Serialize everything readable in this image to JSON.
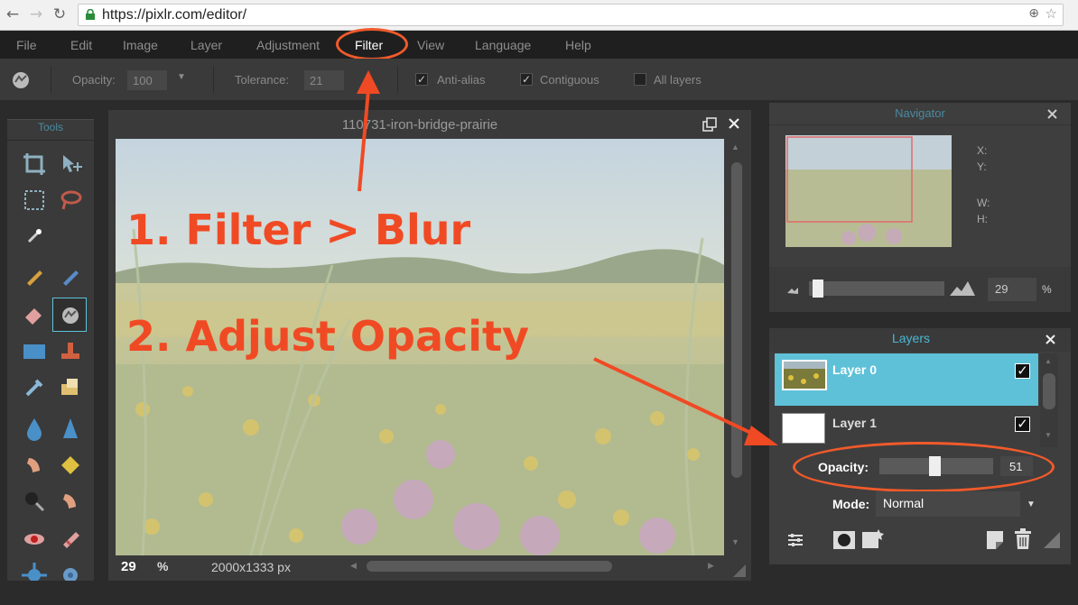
{
  "browser": {
    "url": "https://pixlr.com/editor/"
  },
  "menubar": {
    "items": [
      "File",
      "Edit",
      "Image",
      "Layer",
      "Adjustment",
      "Filter",
      "View",
      "Language",
      "Help"
    ]
  },
  "options": {
    "opacity_label": "Opacity:",
    "opacity_value": "100",
    "tolerance_label": "Tolerance:",
    "tolerance_value": "21",
    "antialias_label": "Anti-alias",
    "contiguous_label": "Contiguous",
    "alllayers_label": "All layers"
  },
  "tools": {
    "title": "Tools"
  },
  "canvas": {
    "title": "110731-iron-bridge-prairie",
    "zoom": "29",
    "zoom_unit": "%",
    "dimensions": "2000x1333 px"
  },
  "navigator": {
    "title": "Navigator",
    "x_label": "X:",
    "y_label": "Y:",
    "w_label": "W:",
    "h_label": "H:",
    "zoom_value": "29",
    "zoom_unit": "%"
  },
  "layers": {
    "title": "Layers",
    "items": [
      {
        "name": "Layer 0",
        "selected": true,
        "visible": true
      },
      {
        "name": "Layer 1",
        "selected": false,
        "visible": true
      }
    ],
    "opacity_label": "Opacity:",
    "opacity_value": "51",
    "mode_label": "Mode:",
    "mode_value": "Normal"
  },
  "annotations": {
    "step1": "1. Filter > Blur",
    "step2": "2. Adjust Opacity"
  },
  "colors": {
    "accent": "#5ec1d8",
    "annotation": "#f04a24"
  },
  "icons": [
    "back-icon",
    "forward-icon",
    "reload-icon",
    "lock-icon",
    "zoom-icon",
    "star-icon",
    "crop-icon",
    "move-icon",
    "marquee-icon",
    "lasso-icon",
    "wand-icon",
    "pencil-icon",
    "brush-icon",
    "eraser-icon",
    "bucket-icon",
    "gradient-icon",
    "stamp-icon",
    "colorpicker-icon",
    "clone-icon",
    "drop-icon",
    "sharpen-icon",
    "smudge-icon",
    "sponge-icon",
    "burn-icon",
    "dodge-icon",
    "redeye-icon",
    "spot-heal-icon",
    "bloat-icon",
    "pinch-icon"
  ]
}
